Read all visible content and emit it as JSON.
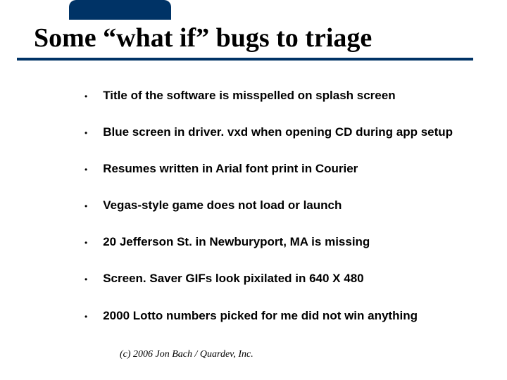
{
  "slide": {
    "title": "Some “what if” bugs to triage",
    "bullets": [
      "Title of the software is misspelled on splash screen",
      "Blue screen in driver. vxd when opening CD during app setup",
      "Resumes written in Arial font print in Courier",
      "Vegas-style game does not load or launch",
      "20 Jefferson St. in Newburyport, MA is missing",
      "Screen. Saver GIFs look pixilated in 640 X 480",
      "2000 Lotto numbers picked for me did not win anything"
    ],
    "footer": "(c) 2006 Jon Bach / Quardev, Inc."
  }
}
